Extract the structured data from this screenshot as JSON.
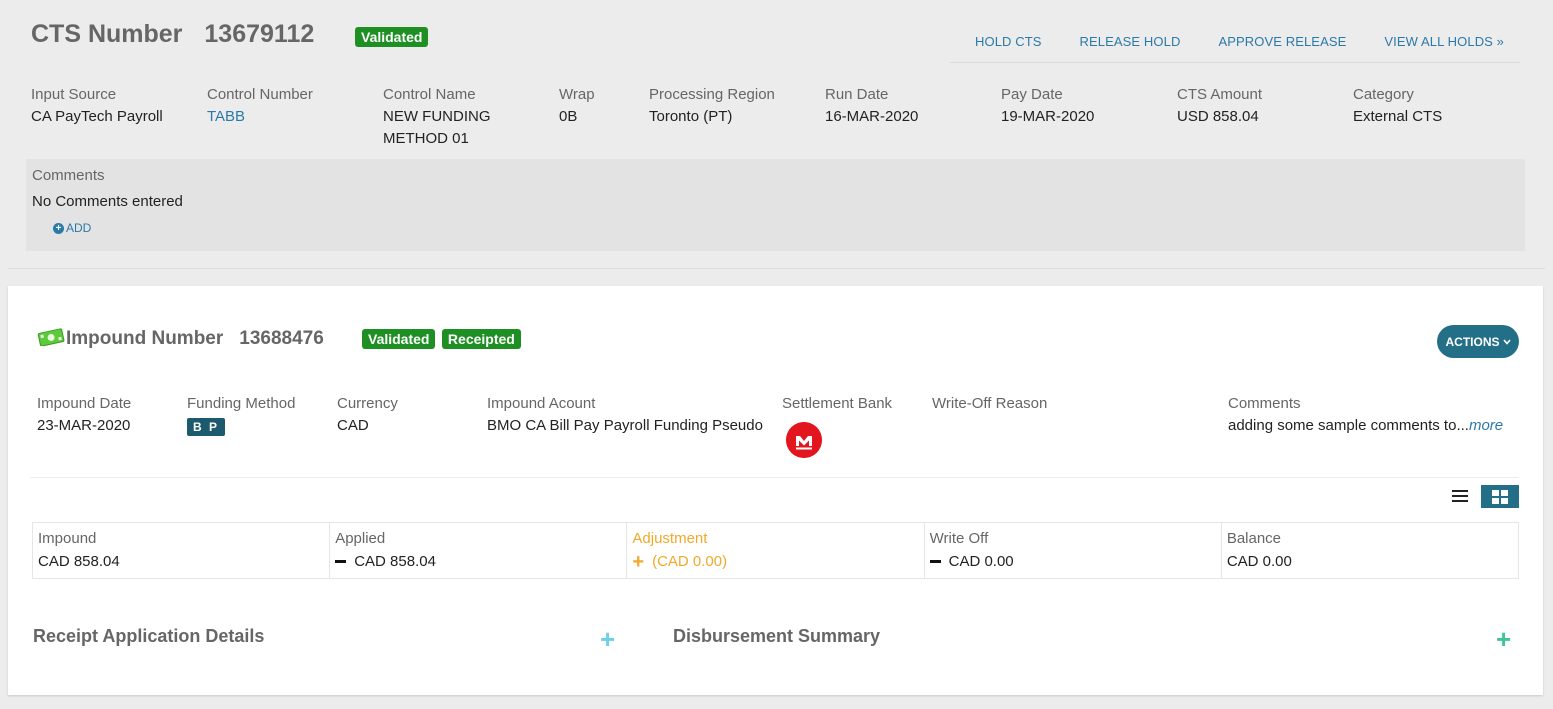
{
  "cts": {
    "title_label": "CTS Number",
    "number": "13679112",
    "status": "Validated",
    "links": [
      "HOLD CTS",
      "RELEASE HOLD",
      "APPROVE RELEASE",
      "VIEW ALL HOLDS »"
    ],
    "fields": [
      {
        "label": "Input Source",
        "value": "CA PayTech Payroll"
      },
      {
        "label": "Control Number",
        "value": "TABB"
      },
      {
        "label": "Control Name",
        "value": "NEW FUNDING METHOD 01"
      },
      {
        "label": "Wrap",
        "value": "0B"
      },
      {
        "label": "Processing Region",
        "value": "Toronto (PT)"
      },
      {
        "label": "Run Date",
        "value": "16-MAR-2020"
      },
      {
        "label": "Pay Date",
        "value": "19-MAR-2020"
      },
      {
        "label": "CTS Amount",
        "value": "USD 858.04"
      },
      {
        "label": "Category",
        "value": "External CTS"
      }
    ],
    "comments": {
      "label": "Comments",
      "value": "No Comments entered",
      "add_label": "ADD"
    }
  },
  "impound": {
    "title_label": "Impound Number",
    "number": "13688476",
    "badges": [
      "Validated",
      "Receipted"
    ],
    "actions_label": "ACTIONS",
    "fields": [
      {
        "label": "Impound Date",
        "value": "23-MAR-2020"
      },
      {
        "label": "Funding Method",
        "value": "B P"
      },
      {
        "label": "Currency",
        "value": "CAD"
      },
      {
        "label": "Impound Acount",
        "value": "BMO CA Bill Pay Payroll Funding Pseudo"
      },
      {
        "label": "Settlement Bank",
        "value": ""
      },
      {
        "label": "Write-Off Reason",
        "value": ""
      },
      {
        "label": "Comments",
        "value": "adding some sample comments to...",
        "more": "more"
      }
    ],
    "summary": [
      {
        "label": "Impound",
        "value": "CAD 858.04"
      },
      {
        "label": "Applied",
        "value": "CAD 858.04"
      },
      {
        "label": "Adjustment",
        "value": "(CAD 0.00)"
      },
      {
        "label": "Write Off",
        "value": "CAD 0.00"
      },
      {
        "label": "Balance",
        "value": "CAD 0.00"
      }
    ],
    "sections": {
      "receipt": "Receipt Application Details",
      "disbursement": "Disbursement Summary"
    }
  },
  "icons": {
    "money": "money-icon",
    "bank": "bmo-bank-icon",
    "list_view": "list-view-icon",
    "grid_view": "grid-view-icon"
  },
  "colors": {
    "accent": "#2a7aa8",
    "badge_green": "#1e8f22",
    "action_teal": "#236f87",
    "adjustment_orange": "#f0a92b",
    "bank_red": "#e3161f",
    "plus_light_blue": "#6cd0e8",
    "plus_green": "#3cc59a"
  }
}
